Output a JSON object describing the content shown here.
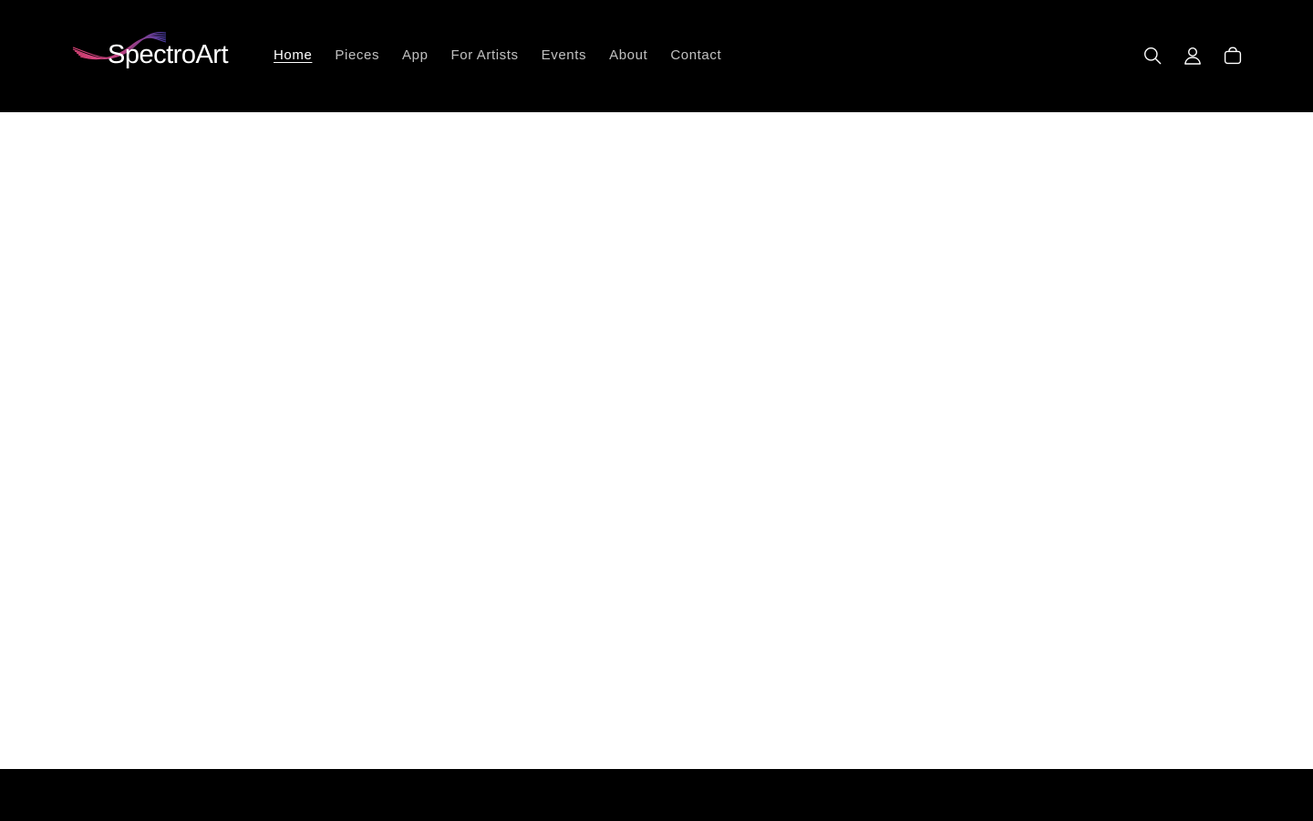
{
  "brand": {
    "name": "SpectroArt",
    "accent_colors": [
      "#e0457b",
      "#8a3fb8",
      "#4b3fa8"
    ]
  },
  "nav": {
    "items": [
      {
        "label": "Home",
        "active": true
      },
      {
        "label": "Pieces",
        "active": false
      },
      {
        "label": "App",
        "active": false
      },
      {
        "label": "For Artists",
        "active": false
      },
      {
        "label": "Events",
        "active": false
      },
      {
        "label": "About",
        "active": false
      },
      {
        "label": "Contact",
        "active": false
      }
    ]
  },
  "header_icons": [
    {
      "name": "search-icon"
    },
    {
      "name": "account-icon"
    },
    {
      "name": "cart-icon"
    }
  ],
  "colors": {
    "header_bg": "#000000",
    "page_bg": "#ffffff",
    "footer_bg": "#000000"
  }
}
